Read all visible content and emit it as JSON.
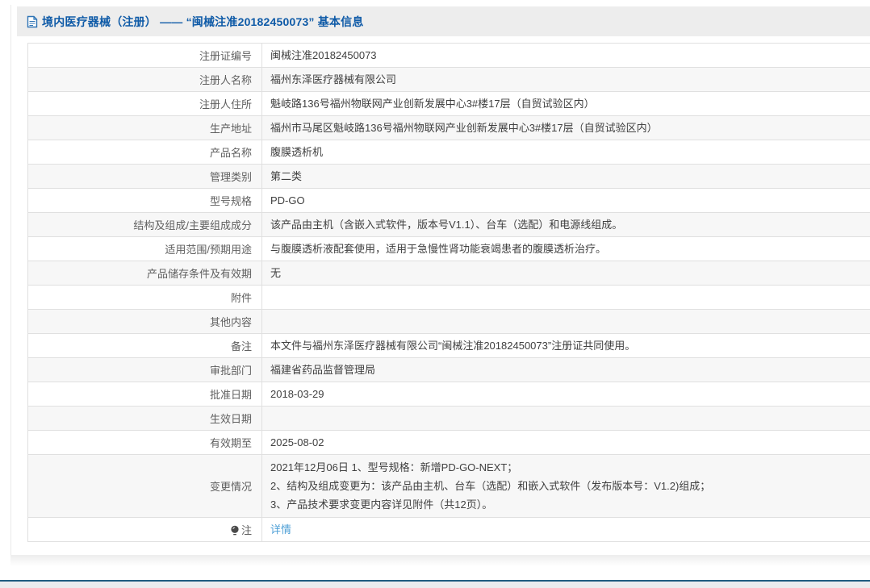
{
  "page": {
    "title": "境内医疗器械（注册） —— “闽械注准20182450073” 基本信息"
  },
  "colors": {
    "title_blue": "#0e5aa7",
    "link_blue": "#4d9fd6",
    "header_bar_bg": "#ededed",
    "zebra_row_bg": "#f7f7f7",
    "footer_line": "#1d5b80"
  },
  "icons": {
    "header": "document-icon",
    "note_row": "bulb-icon"
  },
  "table": {
    "rows": [
      {
        "label": "注册证编号",
        "value": "闽械注准20182450073"
      },
      {
        "label": "注册人名称",
        "value": "福州东泽医疗器械有限公司"
      },
      {
        "label": "注册人住所",
        "value": "魁岐路136号福州物联网产业创新发展中心3#楼17层（自贸试验区内）"
      },
      {
        "label": "生产地址",
        "value": "福州市马尾区魁岐路136号福州物联网产业创新发展中心3#楼17层（自贸试验区内）"
      },
      {
        "label": "产品名称",
        "value": "腹膜透析机"
      },
      {
        "label": "管理类别",
        "value": "第二类"
      },
      {
        "label": "型号规格",
        "value": "PD-GO"
      },
      {
        "label": "结构及组成/主要组成成分",
        "value": "该产品由主机（含嵌入式软件，版本号V1.1）、台车（选配）和电源线组成。"
      },
      {
        "label": "适用范围/预期用途",
        "value": "与腹膜透析液配套使用，适用于急慢性肾功能衰竭患者的腹膜透析治疗。"
      },
      {
        "label": "产品储存条件及有效期",
        "value": "无"
      },
      {
        "label": "附件",
        "value": ""
      },
      {
        "label": "其他内容",
        "value": ""
      },
      {
        "label": "备注",
        "value": "本文件与福州东泽医疗器械有限公司“闽械注准20182450073”注册证共同使用。"
      },
      {
        "label": "审批部门",
        "value": "福建省药品监督管理局"
      },
      {
        "label": "批准日期",
        "value": "2018-03-29"
      },
      {
        "label": "生效日期",
        "value": ""
      },
      {
        "label": "有效期至",
        "value": "2025-08-02"
      },
      {
        "label": "变更情况",
        "lines": [
          "2021年12月06日 1、型号规格：新增PD-GO-NEXT；",
          "2、结构及组成变更为：该产品由主机、台车（选配）和嵌入式软件（发布版本号：V1.2)组成；",
          "3、产品技术要求变更内容详见附件（共12页）。"
        ]
      },
      {
        "label": "注",
        "label_icon": "bulb-icon",
        "value": "详情",
        "link": true
      }
    ]
  }
}
